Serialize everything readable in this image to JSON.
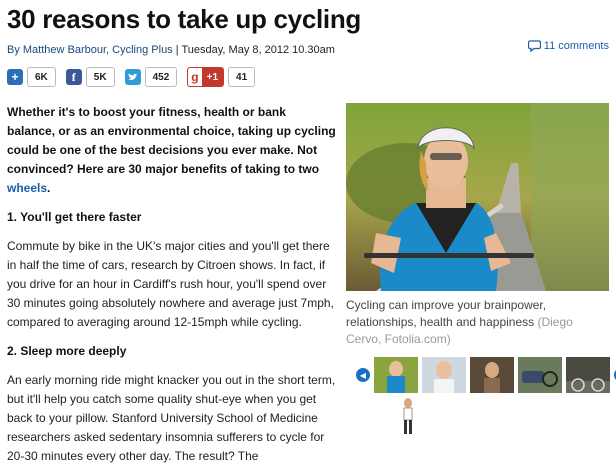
{
  "article": {
    "title": "30 reasons to take up cycling",
    "byline_author": "By Matthew Barbour, Cycling Plus",
    "byline_date": " | Tuesday, May 8, 2012 10.30am",
    "comments_label": "11 comments"
  },
  "share": {
    "add_count": "6K",
    "facebook_count": "5K",
    "twitter_count": "452",
    "gplus_label": "+1",
    "gplus_count": "41"
  },
  "body": {
    "intro": "Whether it's to boost your fitness, health or bank balance, or as an environmental choice, taking up cycling could be one of the best decisions you ever make. Not convinced? Here are 30 major benefits of taking to two ",
    "intro_link": "wheels",
    "intro_end": ".",
    "heading1": "1. You'll get there faster",
    "para1": "Commute by bike in the UK's major cities and you'll get there in half the time of cars, research by Citroen shows. In fact, if you drive for an hour in Cardiff's rush hour, you'll spend over 30 minutes going absolutely nowhere and average just 7mph, compared to averaging around 12-15mph while cycling.",
    "heading2": "2. Sleep more deeply",
    "para2": "An early morning ride might knacker you out in the short term, but it'll help you catch some quality shut-eye when you get back to your pillow. Stanford University School of Medicine researchers asked sedentary insomnia sufferers to cycle for 20-30 minutes every other day. The result? The"
  },
  "gallery": {
    "caption": "Cycling can improve your brainpower, relationships, health and happiness ",
    "credit": "(Diego Cervo, Fotolia.com)"
  },
  "colors": {
    "link": "#1a5fa8",
    "facebook": "#3b5998",
    "twitter": "#2e9cd6",
    "gplus": "#c0392b",
    "add": "#2c6fb5"
  }
}
